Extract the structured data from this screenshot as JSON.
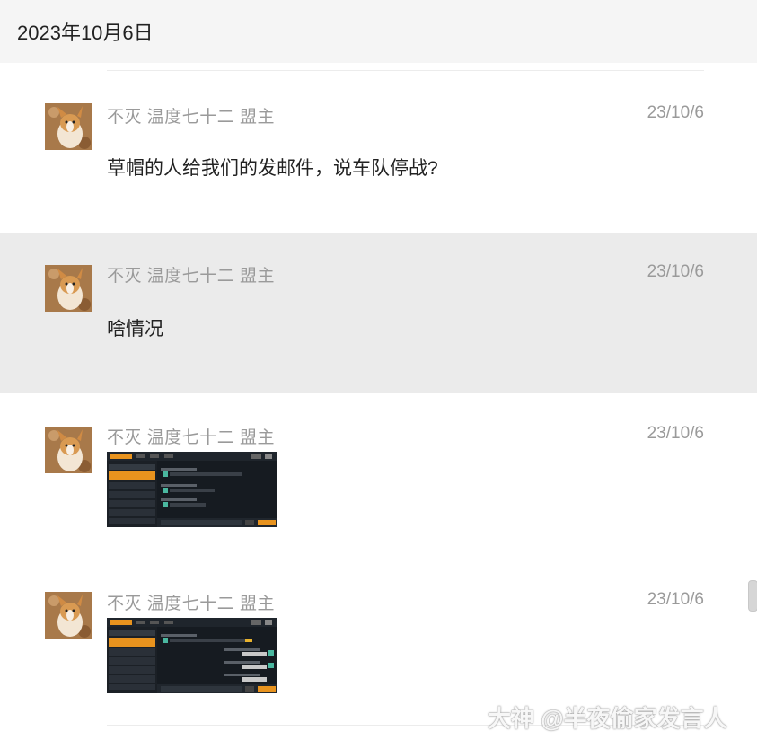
{
  "date_header": "2023年10月6日",
  "messages": [
    {
      "sender": "不灭 温度七十二 盟主",
      "time": "23/10/6",
      "text": "草帽的人给我们的发邮件，说车队停战?"
    },
    {
      "sender": "不灭 温度七十二 盟主",
      "time": "23/10/6",
      "text": "啥情况"
    },
    {
      "sender": "不灭 温度七十二 盟主",
      "time": "23/10/6",
      "image": "game-chat-screenshot"
    },
    {
      "sender": "不灭 温度七十二 盟主",
      "time": "23/10/6",
      "image": "game-chat-screenshot"
    }
  ],
  "watermark": {
    "logo": "大神",
    "text": "@半夜偷家发言人"
  },
  "colors": {
    "highlight": "#ebebeb",
    "header_bg": "#f5f5f5",
    "accent": "#e8931e"
  }
}
